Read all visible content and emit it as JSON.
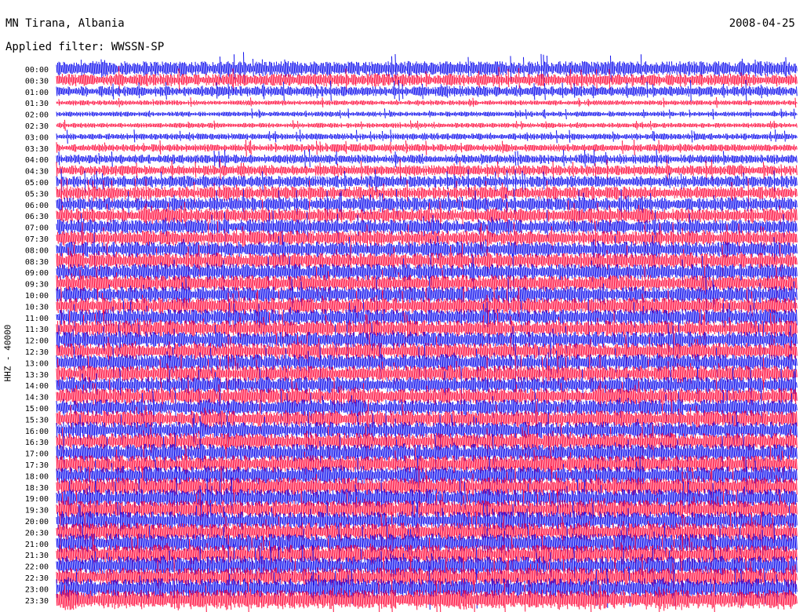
{
  "header": {
    "station": "MN Tirana, Albania",
    "date": "2008-04-25",
    "filter": "Applied filter: WWSSN-SP"
  },
  "chart_data": {
    "type": "line",
    "title": "MN Tirana, Albania",
    "ylabel": "HHZ - 40000",
    "row_labels": [
      "00:00",
      "00:30",
      "01:00",
      "01:30",
      "02:00",
      "02:30",
      "03:00",
      "03:30",
      "04:00",
      "04:30",
      "05:00",
      "05:30",
      "06:00",
      "06:30",
      "07:00",
      "07:30",
      "08:00",
      "08:30",
      "09:00",
      "09:30",
      "10:00",
      "10:30",
      "11:00",
      "11:30",
      "12:00",
      "12:30",
      "13:00",
      "13:30",
      "14:00",
      "14:30",
      "15:00",
      "15:30",
      "16:00",
      "16:30",
      "17:00",
      "17:30",
      "18:00",
      "18:30",
      "19:00",
      "19:30",
      "20:00",
      "20:30",
      "21:00",
      "21:30",
      "22:00",
      "22:30",
      "23:00",
      "23:30"
    ],
    "row_minutes": 30,
    "colors": [
      "#1010ee",
      "#ff1040"
    ],
    "amplitude_level": [
      0.9,
      0.7,
      0.55,
      0.15,
      0.15,
      0.15,
      0.25,
      0.35,
      0.45,
      0.55,
      0.65,
      0.75,
      0.8,
      0.85,
      0.9,
      0.9,
      0.95,
      0.95,
      1.0,
      1.0,
      1.0,
      1.0,
      1.0,
      1.0,
      1.0,
      1.0,
      1.0,
      1.0,
      1.0,
      1.0,
      1.0,
      1.05,
      1.05,
      1.05,
      1.1,
      1.1,
      1.15,
      1.15,
      1.15,
      1.15,
      1.15,
      1.15,
      1.2,
      1.2,
      1.2,
      1.2,
      1.25,
      1.25
    ]
  }
}
